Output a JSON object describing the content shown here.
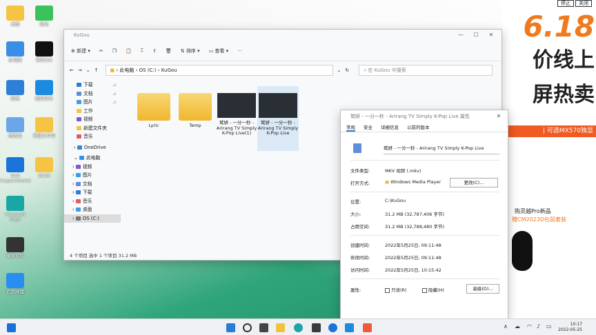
{
  "desktop": {
    "icons": [
      {
        "label": "桌面",
        "color": "#f6c443"
      },
      {
        "label": "微信",
        "color": "#3cc25b"
      },
      {
        "label": "此电脑",
        "color": "#3a8ee6"
      },
      {
        "label": "腾讯QQ",
        "color": "#111111"
      },
      {
        "label": "网络",
        "color": "#2d7fd8"
      },
      {
        "label": "酷狗音乐",
        "color": "#1b8be0"
      },
      {
        "label": "回收站",
        "color": "#6aa6e8"
      },
      {
        "label": "新建文件夹",
        "color": "#f6c443"
      },
      {
        "label": "Dell SupportAssist",
        "color": "#1a73d8"
      },
      {
        "label": "DCIM",
        "color": "#f6c443"
      },
      {
        "label": "Microsoft Edge",
        "color": "#1aa6a6"
      },
      {
        "label": "录屏软件",
        "color": "#333333"
      },
      {
        "label": "百度网盘",
        "color": "#2a8df2"
      }
    ]
  },
  "ad": {
    "close_labels": [
      "停止",
      "关闭"
    ],
    "big_number": "6.18",
    "line1": "价线上",
    "line2": "屏热卖",
    "strip": "| 可选MX570独显",
    "text1": "购灵越Pro新品",
    "text2": "赠CM2023D包鼠套装"
  },
  "explorer": {
    "title": "KuGou",
    "toolbar": {
      "new": "新建",
      "sort": "排序",
      "view": "查看",
      "more": "···"
    },
    "address": [
      "此电脑",
      "OS (C:)",
      "KuGou"
    ],
    "search_placeholder": "在 KuGou 中搜索",
    "nav": [
      {
        "label": "下载",
        "color": "#2e7bd6"
      },
      {
        "label": "文档",
        "color": "#5a8fd6"
      },
      {
        "label": "图片",
        "color": "#3a9ee0"
      },
      {
        "label": "工作",
        "color": "#f6c443"
      },
      {
        "label": "视频",
        "color": "#7b59c7"
      },
      {
        "label": "新建文件夹",
        "color": "#f6c443"
      },
      {
        "label": "音乐",
        "color": "#e05a6a"
      }
    ],
    "onedrive": "OneDrive",
    "thispc": "此电脑",
    "pc_items": [
      {
        "label": "视频",
        "color": "#7b59c7"
      },
      {
        "label": "图片",
        "color": "#3a9ee0"
      },
      {
        "label": "文档",
        "color": "#5a8fd6"
      },
      {
        "label": "下载",
        "color": "#2e7bd6"
      },
      {
        "label": "音乐",
        "color": "#e05a6a"
      },
      {
        "label": "桌面",
        "color": "#3aa0e6"
      },
      {
        "label": "OS (C:)",
        "color": "#777777"
      }
    ],
    "items": [
      {
        "label": "Lyric",
        "kind": "folder"
      },
      {
        "label": "Temp",
        "kind": "folder"
      },
      {
        "label": "鹫妍 - 一分一秒 - Arirang TV Simply K-Pop Live(1)",
        "kind": "video"
      },
      {
        "label": "鹫妍 - 一分一秒 - Arirang TV Simply K-Pop Live",
        "kind": "video"
      }
    ],
    "status": "4 个项目    选中 1 个项目  31.2 MB"
  },
  "properties": {
    "title": "鹫妍 - 一分一秒 - Arirang TV Simply K-Pop Live 属性",
    "tabs": [
      "常规",
      "安全",
      "详细信息",
      "以前的版本"
    ],
    "filename": "鹫妍 - 一分一秒 - Arirang TV Simply K-Pop Live",
    "rows": [
      {
        "key": "文件类型:",
        "value": "MKV 视频 (.mkv)"
      },
      {
        "key": "打开方式:",
        "value": "Windows Media Player"
      },
      {
        "key": "位置:",
        "value": "C:\\KuGou"
      },
      {
        "key": "大小:",
        "value": "31.2 MB (32,787,406 字节)"
      },
      {
        "key": "占用空间:",
        "value": "31.2 MB (32,788,480 字节)"
      },
      {
        "key": "创建时间:",
        "value": "2022年5月25日, 09:11:48"
      },
      {
        "key": "修改时间:",
        "value": "2022年5月25日, 09:11:48"
      },
      {
        "key": "访问时间:",
        "value": "2022年5月25日, 10:15:42"
      },
      {
        "key": "属性:",
        "value": ""
      }
    ],
    "change_button": "更改(C)...",
    "readonly": "只读(R)",
    "hidden": "隐藏(H)",
    "advanced_button": "高级(D)..."
  },
  "taskbar": {
    "time": "10:17",
    "date": "2022-05-25"
  }
}
